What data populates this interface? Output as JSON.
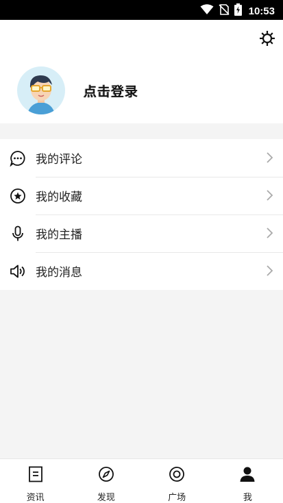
{
  "status_bar": {
    "time": "10:53",
    "icons": [
      "wifi-icon",
      "no-sim-icon",
      "battery-charging-icon"
    ]
  },
  "header": {
    "settings_icon": "gear-icon",
    "avatar": "avatar",
    "login_text": "点击登录"
  },
  "menu": {
    "items": [
      {
        "label": "我的评论",
        "icon": "comment-icon"
      },
      {
        "label": "我的收藏",
        "icon": "star-icon"
      },
      {
        "label": "我的主播",
        "icon": "microphone-icon"
      },
      {
        "label": "我的消息",
        "icon": "speaker-icon"
      }
    ]
  },
  "tabbar": {
    "tabs": [
      {
        "label": "资讯",
        "icon": "news-icon"
      },
      {
        "label": "发现",
        "icon": "compass-icon"
      },
      {
        "label": "广场",
        "icon": "plaza-icon"
      },
      {
        "label": "我",
        "icon": "person-icon",
        "active": true
      }
    ]
  },
  "colors": {
    "status_bar": "#000000",
    "page_background": "#f4f4f4",
    "card_background": "#ffffff",
    "avatar_background": "#d7eef7"
  }
}
